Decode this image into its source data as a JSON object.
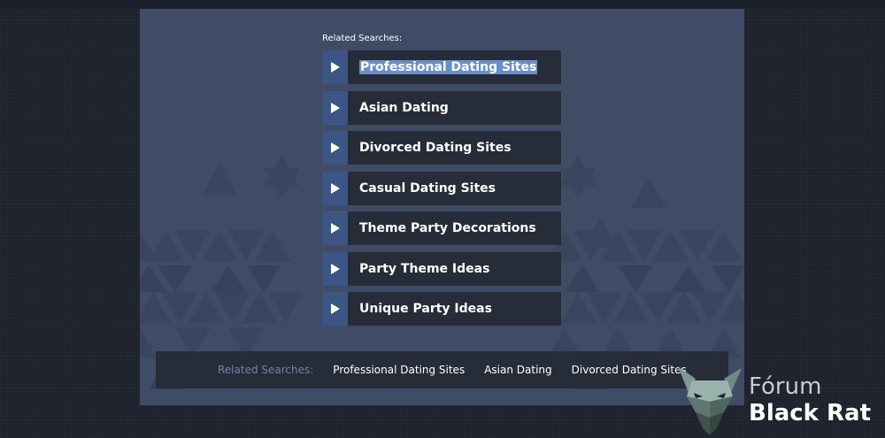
{
  "related_heading": "Related Searches:",
  "items": [
    {
      "label": "Professional Dating Sites"
    },
    {
      "label": "Asian Dating"
    },
    {
      "label": "Divorced Dating Sites"
    },
    {
      "label": "Casual Dating Sites"
    },
    {
      "label": "Theme Party Decorations"
    },
    {
      "label": "Party Theme Ideas"
    },
    {
      "label": "Unique Party Ideas"
    }
  ],
  "bottom_bar": {
    "label": "Related Searches:",
    "links": [
      "Professional Dating Sites",
      "Asian Dating",
      "Divorced Dating Sites"
    ]
  },
  "watermark": {
    "line1": "Fórum",
    "line2": "Black Rat"
  },
  "colors": {
    "page_bg": "#1d222d",
    "panel_bg": "#404c66",
    "arrow_bg": "#3c5584",
    "item_bg": "#262c38",
    "bottom_label": "#6f83a6",
    "highlight": "#6a8fc8"
  }
}
